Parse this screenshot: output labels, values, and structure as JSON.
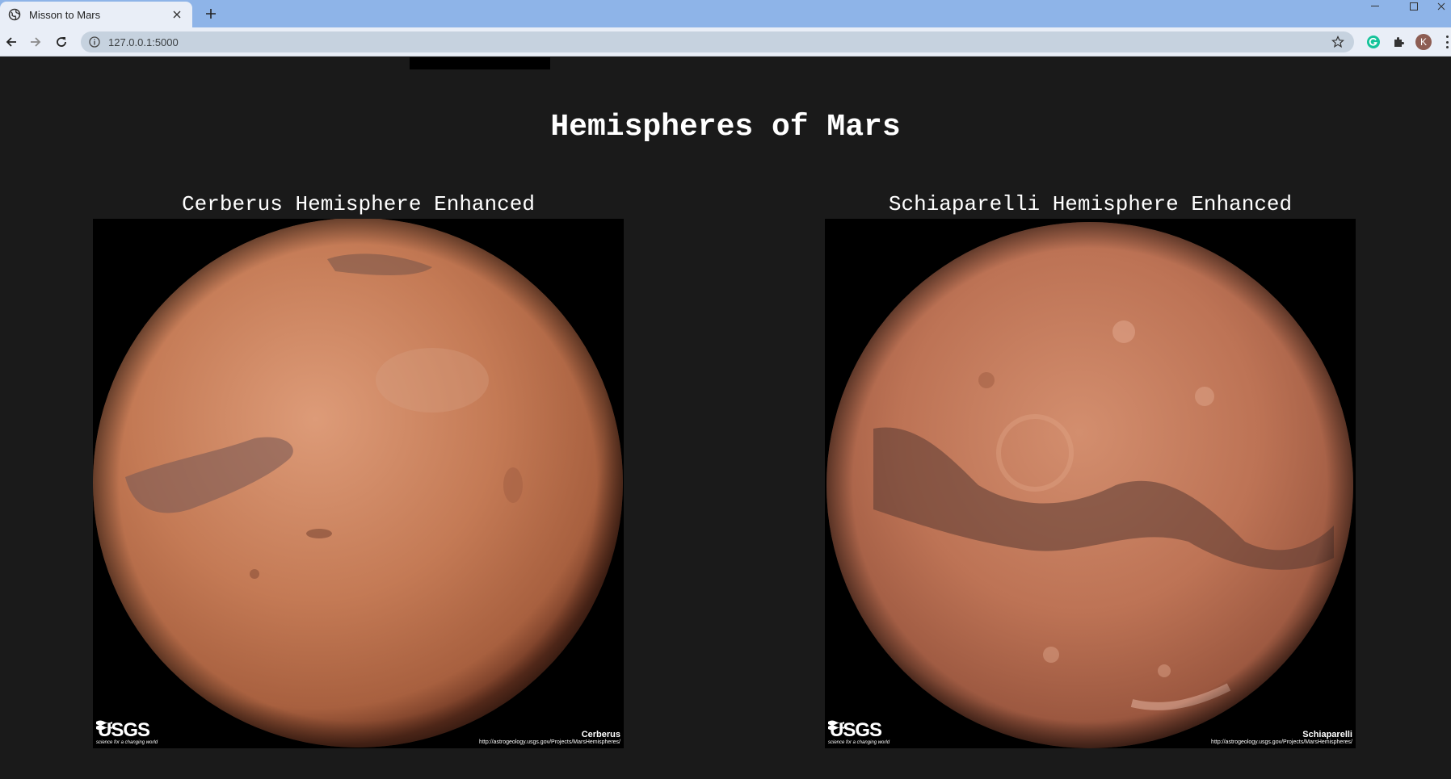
{
  "browser": {
    "tab_title": "Misson to Mars",
    "url": "127.0.0.1:5000",
    "profile_initial": "K"
  },
  "page": {
    "title": "Hemispheres of Mars",
    "hemispheres": [
      {
        "title": "Cerberus Hemisphere Enhanced",
        "image_label": "Cerberus",
        "logo_text": "USGS",
        "logo_tagline": "science for a changing world",
        "credit_url": "http://astrogeology.usgs.gov/Projects/MarsHemispheres/"
      },
      {
        "title": "Schiaparelli Hemisphere Enhanced",
        "image_label": "Schiaparelli",
        "logo_text": "USGS",
        "logo_tagline": "science for a changing world",
        "credit_url": "http://astrogeology.usgs.gov/Projects/MarsHemispheres/"
      }
    ]
  },
  "colors": {
    "page_background": "#1a1a1a",
    "browser_frame": "#8eb4e8",
    "mars_base": "#c0704a"
  }
}
